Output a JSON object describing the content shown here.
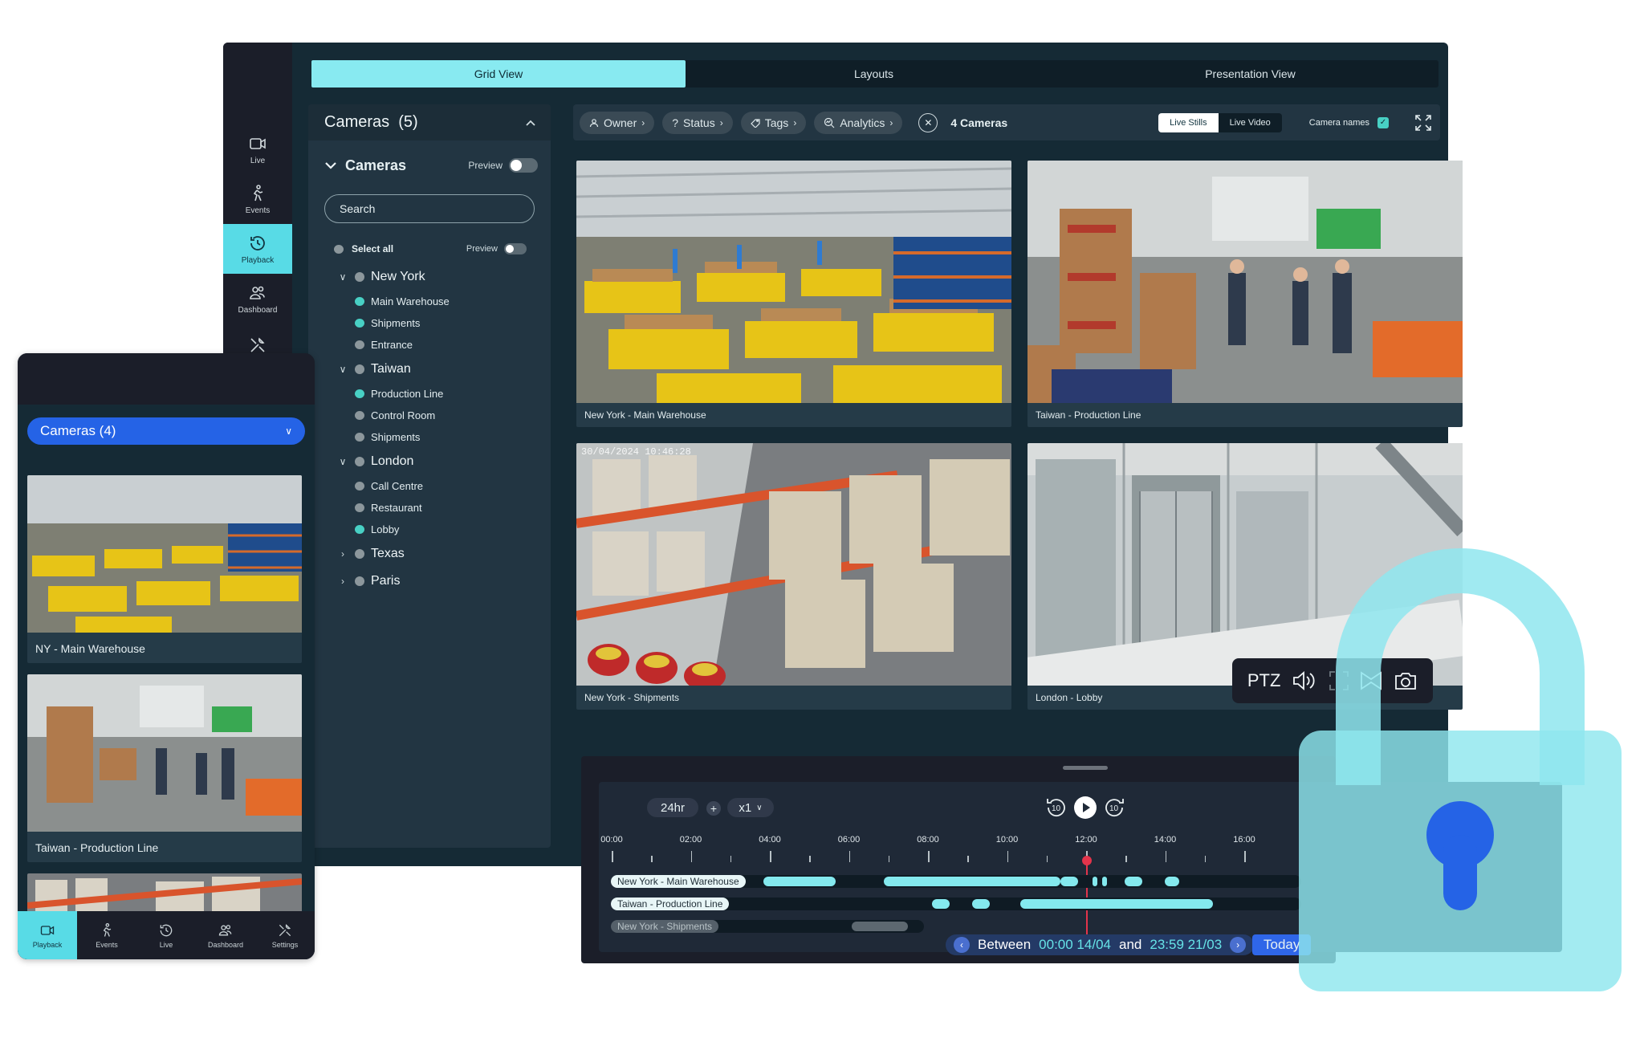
{
  "desktop": {
    "nav_rail": [
      {
        "label": "Live",
        "icon": "camera-icon",
        "active": false
      },
      {
        "label": "Events",
        "icon": "person-walking-icon",
        "active": false
      },
      {
        "label": "Playback",
        "icon": "history-clock-icon",
        "active": true
      },
      {
        "label": "Dashboard",
        "icon": "users-icon",
        "active": false
      },
      {
        "label": "",
        "icon": "tools-icon",
        "active": false
      }
    ],
    "view_tabs": [
      {
        "label": "Grid View",
        "active": true
      },
      {
        "label": "Layouts",
        "active": false
      },
      {
        "label": "Presentation View",
        "active": false
      }
    ],
    "camera_panel": {
      "title": "Cameras",
      "count": "(5)",
      "section_title": "Cameras",
      "preview_label": "Preview",
      "search_placeholder": "Search",
      "select_all": "Select all",
      "select_all_preview": "Preview",
      "groups": [
        {
          "name": "New York",
          "expanded": true,
          "cameras": [
            {
              "name": "Main Warehouse",
              "selected": true
            },
            {
              "name": "Shipments",
              "selected": true
            },
            {
              "name": "Entrance",
              "selected": false
            }
          ]
        },
        {
          "name": "Taiwan",
          "expanded": true,
          "cameras": [
            {
              "name": "Production Line",
              "selected": true
            },
            {
              "name": "Control Room",
              "selected": false
            },
            {
              "name": "Shipments",
              "selected": false
            }
          ]
        },
        {
          "name": "London",
          "expanded": true,
          "cameras": [
            {
              "name": "Call Centre",
              "selected": false
            },
            {
              "name": "Restaurant",
              "selected": false
            },
            {
              "name": "Lobby",
              "selected": true
            }
          ]
        },
        {
          "name": "Texas",
          "expanded": false,
          "cameras": []
        },
        {
          "name": "Paris",
          "expanded": false,
          "cameras": []
        }
      ]
    },
    "filters": {
      "chips": [
        {
          "label": "Owner",
          "icon": "person-icon"
        },
        {
          "label": "Status",
          "icon": "question-icon"
        },
        {
          "label": "Tags",
          "icon": "tag-icon"
        },
        {
          "label": "Analytics",
          "icon": "analytics-search-icon"
        }
      ],
      "camera_count": "4 Cameras",
      "modes": [
        {
          "label": "Live Stills",
          "active": true
        },
        {
          "label": "Live Video",
          "active": false
        }
      ],
      "camera_names_label": "Camera names",
      "camera_names_checked": true
    },
    "tiles": [
      {
        "caption": "New York - Main Warehouse",
        "scene": "warehouse"
      },
      {
        "caption": "Taiwan - Production Line",
        "scene": "production"
      },
      {
        "caption": "New York - Shipments",
        "scene": "shelves",
        "timestamp": "30/04/2024 10:46:28"
      },
      {
        "caption": "London - Lobby",
        "scene": "lobby"
      }
    ],
    "ptz": {
      "label": "PTZ"
    },
    "timeline": {
      "range": "24hr",
      "speed": "x1",
      "rewind_label": "10",
      "forward_label": "10",
      "ticks": [
        "00:00",
        "02:00",
        "04:00",
        "06:00",
        "08:00",
        "10:00",
        "12:00",
        "14:00",
        "16:00"
      ],
      "playhead_time": "12:00",
      "tracks": [
        {
          "label": "New York - Main Warehouse",
          "dim": false
        },
        {
          "label": "Taiwan - Production Line",
          "dim": false
        },
        {
          "label": "New York - Shipments",
          "dim": true
        }
      ],
      "between": "Between",
      "from": "00:00 14/04",
      "and": "and",
      "to": "23:59 21/03",
      "today": "Today"
    }
  },
  "phone": {
    "selector": "Cameras (4)",
    "cards": [
      {
        "caption": "NY - Main Warehouse",
        "scene": "warehouse"
      },
      {
        "caption": "Taiwan - Production Line",
        "scene": "production"
      },
      {
        "caption": "",
        "scene": "shelves"
      }
    ],
    "tabs": [
      {
        "label": "Playback",
        "icon": "camera-icon",
        "active": true
      },
      {
        "label": "Events",
        "icon": "person-walking-icon",
        "active": false
      },
      {
        "label": "Live",
        "icon": "history-clock-icon",
        "active": false
      },
      {
        "label": "Dashboard",
        "icon": "users-icon",
        "active": false
      },
      {
        "label": "Settings",
        "icon": "tools-icon",
        "active": false
      }
    ]
  },
  "colors": {
    "accent_cyan": "#58dbe6",
    "app_bg": "#152a35",
    "rail_bg": "#1b1e29",
    "primary_blue": "#2563e6",
    "playhead_red": "#e3344b",
    "lock_cyan": "#8fe6ee"
  }
}
